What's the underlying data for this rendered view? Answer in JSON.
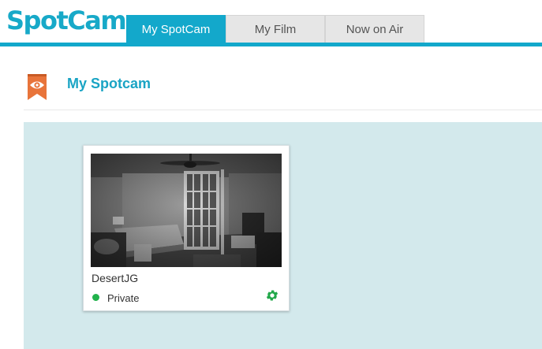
{
  "header": {
    "logo": "SpotCam",
    "tabs": [
      {
        "label": "My SpotCam",
        "active": true
      },
      {
        "label": "My Film",
        "active": false
      },
      {
        "label": "Now on Air",
        "active": false
      }
    ]
  },
  "section": {
    "title": "My Spotcam",
    "icon": "bookmark-eye-icon"
  },
  "cameras": [
    {
      "name": "DesertJG",
      "status": "Private",
      "status_color": "#22b24c",
      "settings_icon": "gear-icon"
    }
  ],
  "colors": {
    "brand": "#13a8cb",
    "panel_bg": "#d3e9ec",
    "bookmark": "#e8743a"
  }
}
